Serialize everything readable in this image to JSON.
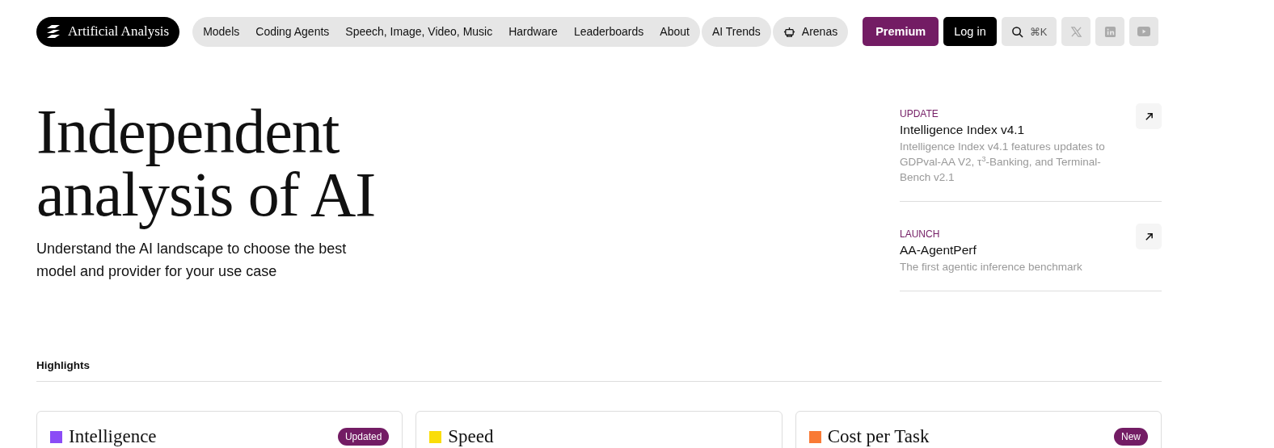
{
  "logo": {
    "text": "Artificial Analysis"
  },
  "nav": {
    "groups": [
      {
        "items": [
          "Models",
          "Coding Agents",
          "Speech, Image, Video, Music",
          "Hardware",
          "Leaderboards",
          "About"
        ]
      },
      {
        "items": [
          "AI Trends"
        ]
      },
      {
        "items": [
          "Arenas"
        ]
      }
    ]
  },
  "actions": {
    "premium": "Premium",
    "login": "Log in",
    "search_shortcut": "⌘K"
  },
  "hero": {
    "title_lines": [
      "Independent",
      "analysis of AI"
    ],
    "subtitle": "Understand the AI landscape to choose the best model and provider for your use case"
  },
  "news": [
    {
      "tag": "UPDATE",
      "title": "Intelligence Index v4.1",
      "description": "Intelligence Index v4.1 features updates to GDPval-AA V2, τ$^{3}$-Banking, and Terminal-Bench v2.1"
    },
    {
      "tag": "LAUNCH",
      "title": "AA-AgentPerf",
      "description": "The first agentic inference benchmark"
    }
  ],
  "highlights": {
    "heading": "Highlights",
    "cards": [
      {
        "title": "Intelligence",
        "color": "#8b4cf6",
        "badge": "Updated"
      },
      {
        "title": "Speed",
        "color": "#fadd0a"
      },
      {
        "title": "Cost per Task",
        "color": "#f97a35",
        "badge": "New"
      }
    ]
  }
}
